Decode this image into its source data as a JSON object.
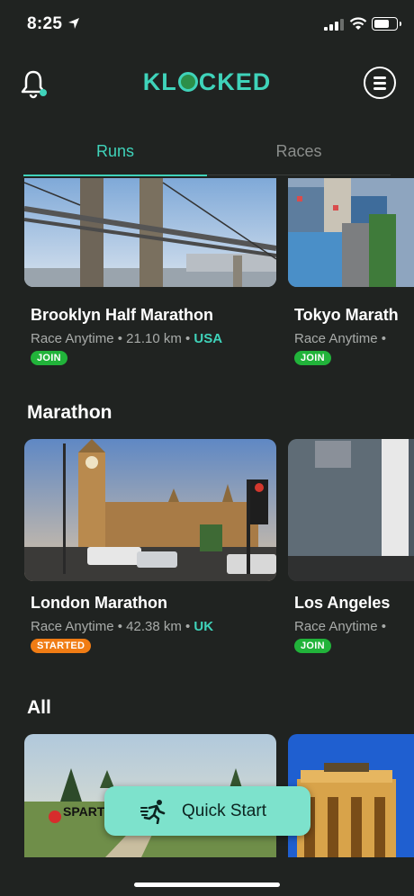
{
  "status_bar": {
    "time": "8:25"
  },
  "header": {
    "logo_text_before": "KL",
    "logo_text_after": "CKED"
  },
  "tabs": [
    {
      "label": "Runs"
    },
    {
      "label": "Races"
    }
  ],
  "featured": [
    {
      "name": "Brooklyn Half Marathon",
      "meta": "Race Anytime • 21.10 km •",
      "country": "USA",
      "badge": "JOIN"
    },
    {
      "name": "Tokyo Marath",
      "meta": "Race Anytime •",
      "badge": "JOIN"
    }
  ],
  "sections": {
    "marathon": "Marathon",
    "all": "All"
  },
  "marathon": [
    {
      "name": "London Marathon",
      "meta": "Race Anytime • 42.38 km •",
      "country": "UK",
      "badge": "STARTED"
    },
    {
      "name": "Los Angeles",
      "meta": "Race Anytime •",
      "badge": "JOIN"
    }
  ],
  "all_cards": [
    {
      "image_text": "SPART"
    }
  ],
  "quick_start": {
    "label": "Quick Start"
  },
  "colors": {
    "background": "#202321",
    "accent": "#3fd3ba",
    "join": "#21b33a",
    "started": "#f07c14"
  }
}
